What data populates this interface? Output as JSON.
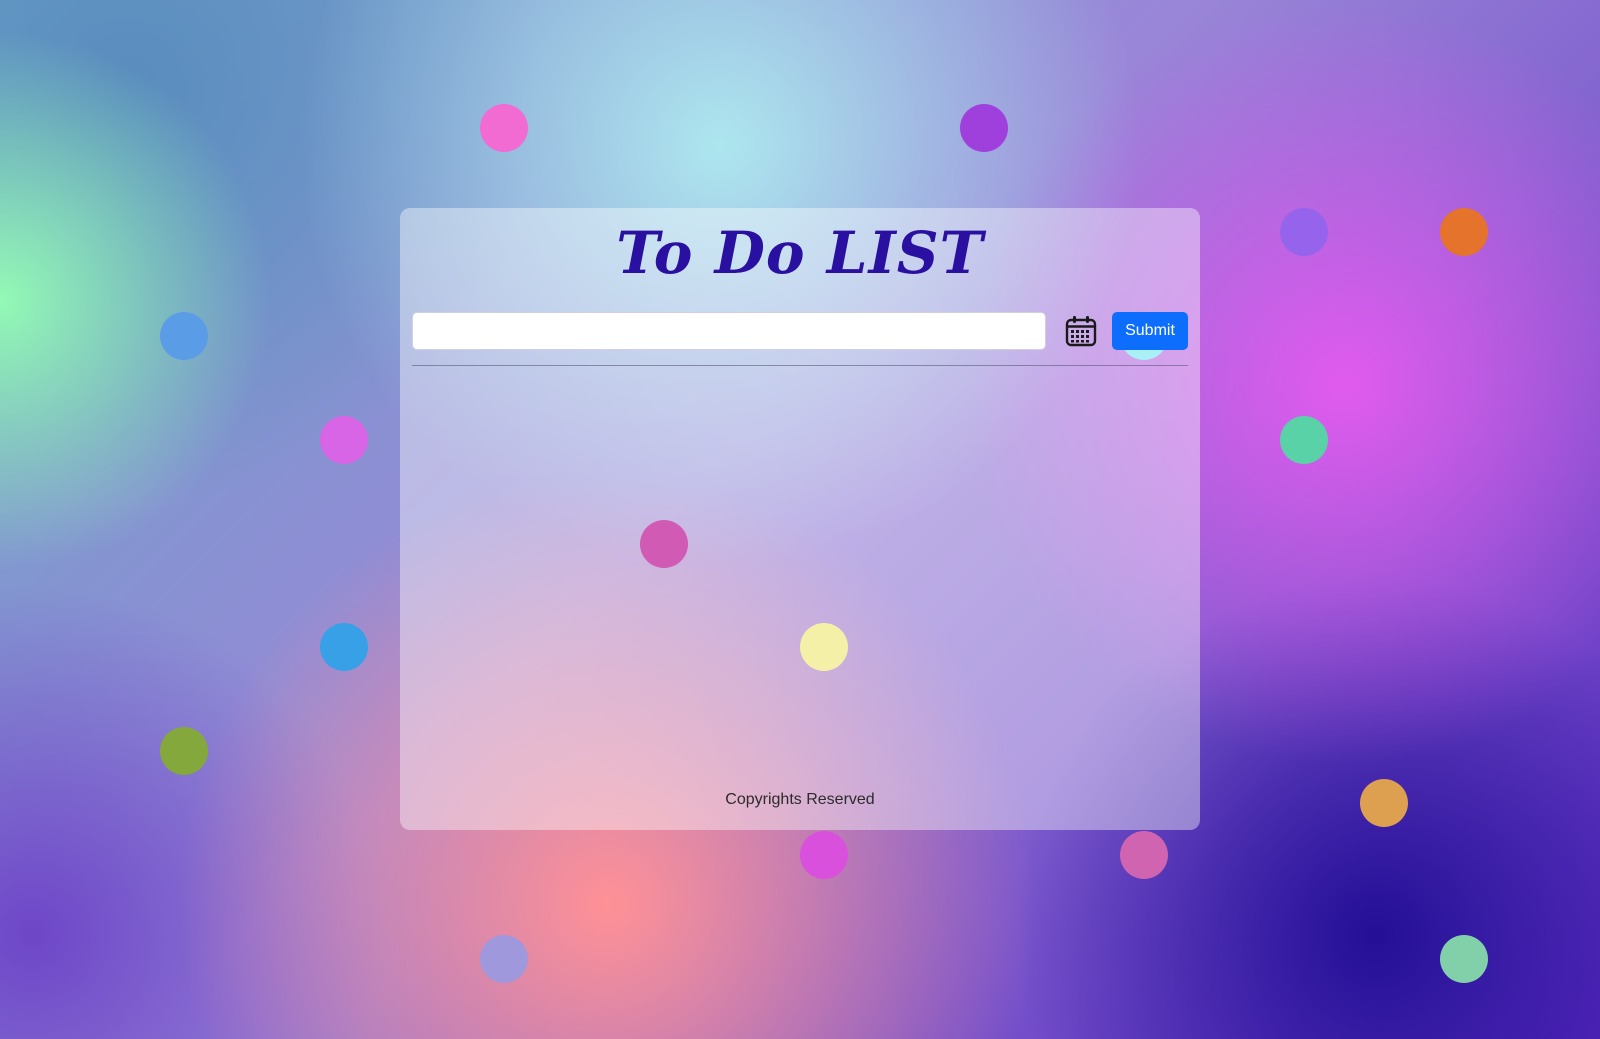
{
  "app": {
    "title": "To Do LIST",
    "input_value": "",
    "submit_label": "Submit",
    "calendar_icon": "calendar-icon",
    "footer_text": "Copyrights Reserved",
    "accent_color": "#0d6efd",
    "title_color": "#2a10a0"
  },
  "decoration": {
    "dot_colors": [
      "#f26bd3",
      "#a040dc",
      "#9664ec",
      "#e6732c",
      "#5a9ce6",
      "#5ad2a8",
      "#d864e6",
      "#d05ab4",
      "#f4f0a8",
      "#38a0e6",
      "#84a83c",
      "#dca050",
      "#d850dc",
      "#d064b0",
      "#a098dc",
      "#82d0aa",
      "#6ee6f0"
    ]
  }
}
